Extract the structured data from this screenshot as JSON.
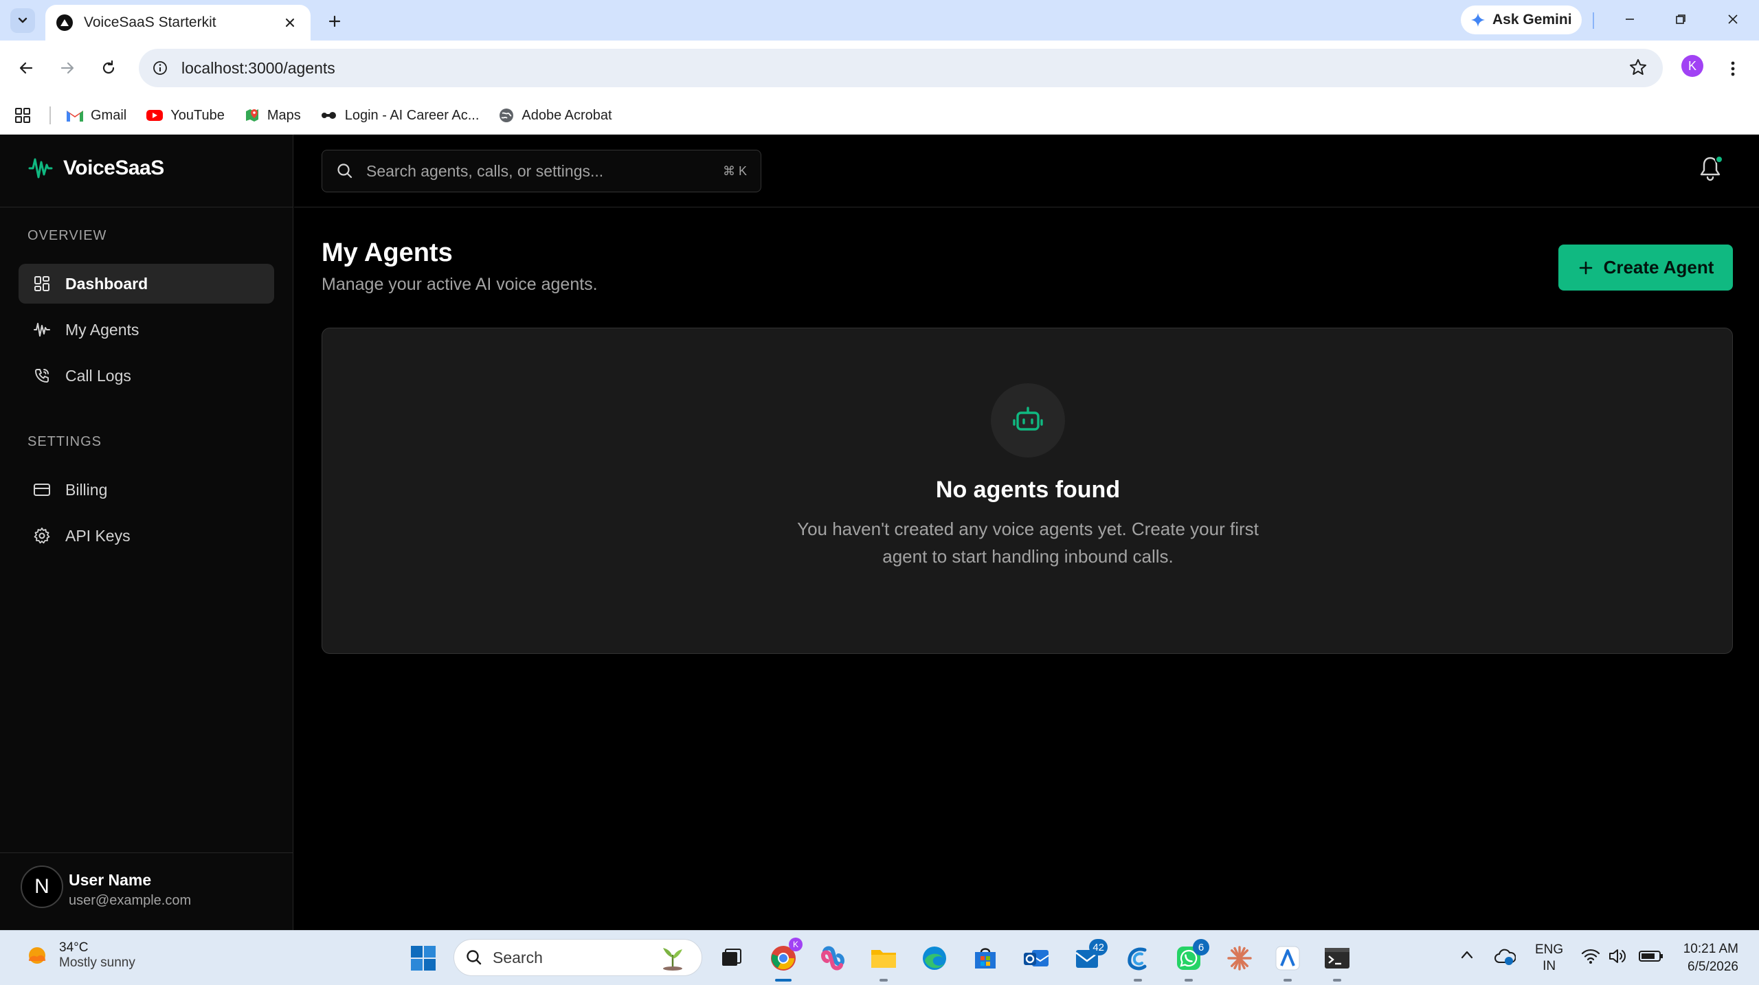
{
  "browser": {
    "tab_title": "VoiceSaaS Starterkit",
    "gemini_label": "Ask Gemini",
    "url": "localhost:3000/agents",
    "profile_initial": "K",
    "bookmarks": [
      {
        "label": "Gmail",
        "icon": "gmail-icon"
      },
      {
        "label": "YouTube",
        "icon": "youtube-icon"
      },
      {
        "label": "Maps",
        "icon": "maps-icon"
      },
      {
        "label": "Login - AI Career Ac...",
        "icon": "career-icon"
      },
      {
        "label": "Adobe Acrobat",
        "icon": "globe-icon"
      }
    ]
  },
  "app": {
    "brand": "VoiceSaaS",
    "search_placeholder": "Search agents, calls, or settings...",
    "search_shortcut": "⌘ K",
    "sidebar": {
      "overview_label": "OVERVIEW",
      "settings_label": "SETTINGS",
      "items": [
        {
          "label": "Dashboard",
          "icon": "dashboard-icon",
          "active": true
        },
        {
          "label": "My Agents",
          "icon": "waveform-icon",
          "active": false
        },
        {
          "label": "Call Logs",
          "icon": "phone-icon",
          "active": false
        },
        {
          "label": "Billing",
          "icon": "credit-card-icon",
          "active": false
        },
        {
          "label": "API Keys",
          "icon": "gear-icon",
          "active": false
        }
      ]
    },
    "user": {
      "initial": "N",
      "name": "User Name",
      "email": "user@example.com"
    },
    "page": {
      "title": "My Agents",
      "subtitle": "Manage your active AI voice agents.",
      "create_button": "Create Agent",
      "empty_title": "No agents found",
      "empty_description": "You haven't created any voice agents yet. Create your first agent to start handling inbound calls."
    },
    "colors": {
      "accent": "#10b981",
      "background": "#000000",
      "card": "#1a1a1a"
    }
  },
  "taskbar": {
    "weather_temp": "34°C",
    "weather_desc": "Mostly sunny",
    "search_label": "Search",
    "badges": {
      "outlook": "42",
      "whatsapp": "6"
    },
    "lang_line1": "ENG",
    "lang_line2": "IN",
    "time": "10:21 AM",
    "date": "6/5/2026"
  }
}
